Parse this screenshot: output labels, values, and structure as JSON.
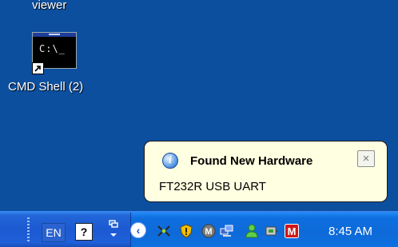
{
  "desktop": {
    "partial_label": "viewer",
    "shortcut": {
      "icon_text": "C:\\_",
      "label": "CMD Shell (2)"
    }
  },
  "balloon": {
    "title": "Found New Hardware",
    "message": "FT232R USB UART",
    "close_glyph": "×"
  },
  "taskbar": {
    "language": "EN",
    "help_glyph": "?",
    "tray_chevron": "‹",
    "clock": "8:45 AM"
  }
}
